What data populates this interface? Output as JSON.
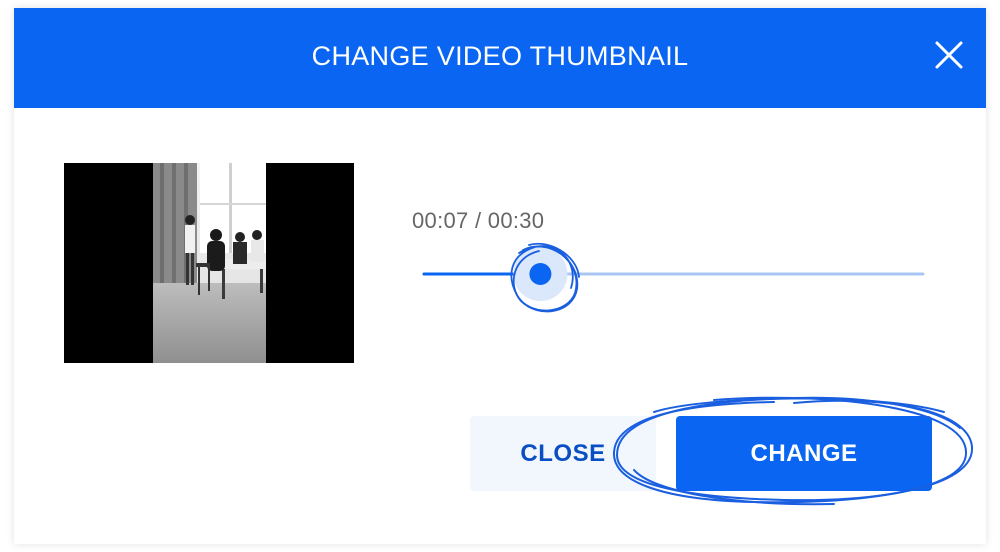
{
  "dialog": {
    "title": "CHANGE VIDEO THUMBNAIL",
    "close_icon": "close-icon"
  },
  "player": {
    "time_display": "00:07 / 00:30",
    "progress": 0.2333
  },
  "buttons": {
    "close_label": "CLOSE",
    "change_label": "CHANGE"
  },
  "colors": {
    "primary": "#0a66f2",
    "track": "#a9c6f5",
    "close_bg": "#f2f7fd",
    "close_text": "#0a4ec4",
    "annotation": "#1a5fe0"
  }
}
